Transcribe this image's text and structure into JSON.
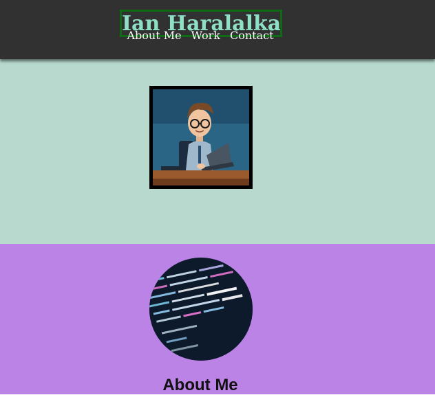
{
  "header": {
    "title": "Ian Haralalka",
    "nav": [
      {
        "label": "About Me"
      },
      {
        "label": "Work"
      },
      {
        "label": "Contact"
      }
    ]
  },
  "hero": {
    "image": "cartoon-developer-at-laptop"
  },
  "about": {
    "image": "code-screen-circle",
    "heading": "About Me"
  },
  "colors": {
    "header_bg": "#313131",
    "title_text": "#8ee0c6",
    "title_border": "#0f6a16",
    "hero_bg": "#b8dace",
    "about_bg": "#bb83e6"
  }
}
